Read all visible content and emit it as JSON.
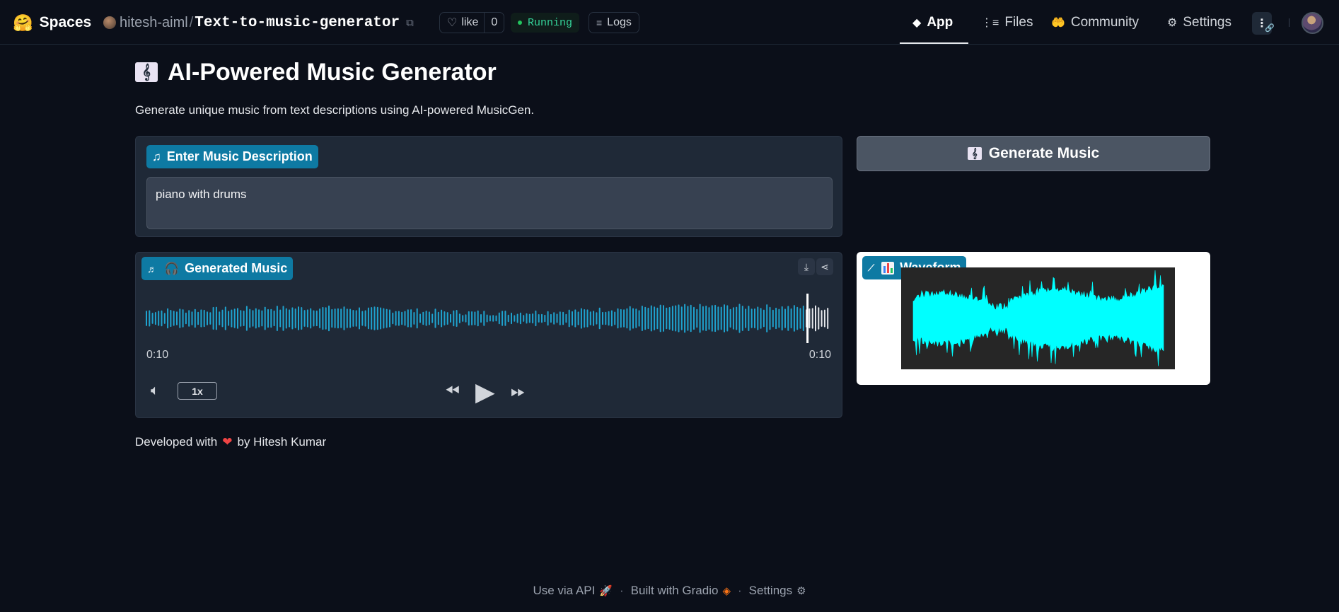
{
  "topbar": {
    "brand": "Spaces",
    "owner": "hitesh-aiml",
    "repo_name": "Text-to-music-generator",
    "like_label": "like",
    "like_count": "0",
    "status": "Running",
    "logs_label": "Logs",
    "tabs": [
      {
        "label": "App",
        "icon": "cube-icon",
        "active": true
      },
      {
        "label": "Files",
        "icon": "files-icon",
        "active": false
      },
      {
        "label": "Community",
        "icon": "community-icon",
        "active": false
      },
      {
        "label": "Settings",
        "icon": "gear-icon",
        "active": false
      }
    ]
  },
  "main": {
    "title": "AI-Powered Music Generator",
    "description": "Generate unique music from text descriptions using AI-powered MusicGen.",
    "input": {
      "label": "Enter Music Description",
      "value": "piano with drums"
    },
    "generate_button": "Generate Music",
    "audio": {
      "label": "Generated Music",
      "time_current": "0:10",
      "time_total": "0:10",
      "speed": "1x",
      "progress": 0.963
    },
    "waveform": {
      "label": "Waveform"
    },
    "developer_note": {
      "prefix": "Developed with",
      "suffix": "by Hitesh Kumar"
    }
  },
  "footer": {
    "api": "Use via API",
    "gradio": "Built with Gradio",
    "settings": "Settings"
  },
  "colors": {
    "background": "#0b0f19",
    "panel": "#1f2937",
    "accent_chip": "#0e7aa3",
    "waveform_played": "#1fa3cf",
    "waveform_unplayed": "#e5e7eb",
    "waveform_plot": "#00ffff",
    "running": "#22c55e"
  }
}
